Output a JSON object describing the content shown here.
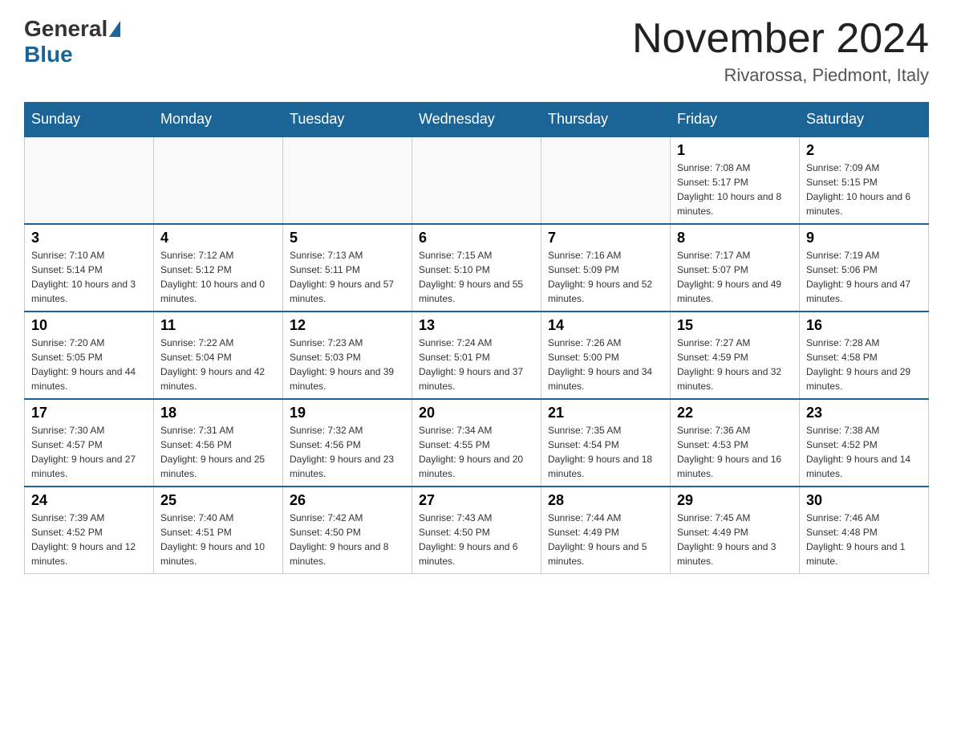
{
  "header": {
    "logo_general": "General",
    "logo_blue": "Blue",
    "month_year": "November 2024",
    "location": "Rivarossa, Piedmont, Italy"
  },
  "days_of_week": [
    "Sunday",
    "Monday",
    "Tuesday",
    "Wednesday",
    "Thursday",
    "Friday",
    "Saturday"
  ],
  "weeks": [
    [
      {
        "day": "",
        "info": ""
      },
      {
        "day": "",
        "info": ""
      },
      {
        "day": "",
        "info": ""
      },
      {
        "day": "",
        "info": ""
      },
      {
        "day": "",
        "info": ""
      },
      {
        "day": "1",
        "info": "Sunrise: 7:08 AM\nSunset: 5:17 PM\nDaylight: 10 hours and 8 minutes."
      },
      {
        "day": "2",
        "info": "Sunrise: 7:09 AM\nSunset: 5:15 PM\nDaylight: 10 hours and 6 minutes."
      }
    ],
    [
      {
        "day": "3",
        "info": "Sunrise: 7:10 AM\nSunset: 5:14 PM\nDaylight: 10 hours and 3 minutes."
      },
      {
        "day": "4",
        "info": "Sunrise: 7:12 AM\nSunset: 5:12 PM\nDaylight: 10 hours and 0 minutes."
      },
      {
        "day": "5",
        "info": "Sunrise: 7:13 AM\nSunset: 5:11 PM\nDaylight: 9 hours and 57 minutes."
      },
      {
        "day": "6",
        "info": "Sunrise: 7:15 AM\nSunset: 5:10 PM\nDaylight: 9 hours and 55 minutes."
      },
      {
        "day": "7",
        "info": "Sunrise: 7:16 AM\nSunset: 5:09 PM\nDaylight: 9 hours and 52 minutes."
      },
      {
        "day": "8",
        "info": "Sunrise: 7:17 AM\nSunset: 5:07 PM\nDaylight: 9 hours and 49 minutes."
      },
      {
        "day": "9",
        "info": "Sunrise: 7:19 AM\nSunset: 5:06 PM\nDaylight: 9 hours and 47 minutes."
      }
    ],
    [
      {
        "day": "10",
        "info": "Sunrise: 7:20 AM\nSunset: 5:05 PM\nDaylight: 9 hours and 44 minutes."
      },
      {
        "day": "11",
        "info": "Sunrise: 7:22 AM\nSunset: 5:04 PM\nDaylight: 9 hours and 42 minutes."
      },
      {
        "day": "12",
        "info": "Sunrise: 7:23 AM\nSunset: 5:03 PM\nDaylight: 9 hours and 39 minutes."
      },
      {
        "day": "13",
        "info": "Sunrise: 7:24 AM\nSunset: 5:01 PM\nDaylight: 9 hours and 37 minutes."
      },
      {
        "day": "14",
        "info": "Sunrise: 7:26 AM\nSunset: 5:00 PM\nDaylight: 9 hours and 34 minutes."
      },
      {
        "day": "15",
        "info": "Sunrise: 7:27 AM\nSunset: 4:59 PM\nDaylight: 9 hours and 32 minutes."
      },
      {
        "day": "16",
        "info": "Sunrise: 7:28 AM\nSunset: 4:58 PM\nDaylight: 9 hours and 29 minutes."
      }
    ],
    [
      {
        "day": "17",
        "info": "Sunrise: 7:30 AM\nSunset: 4:57 PM\nDaylight: 9 hours and 27 minutes."
      },
      {
        "day": "18",
        "info": "Sunrise: 7:31 AM\nSunset: 4:56 PM\nDaylight: 9 hours and 25 minutes."
      },
      {
        "day": "19",
        "info": "Sunrise: 7:32 AM\nSunset: 4:56 PM\nDaylight: 9 hours and 23 minutes."
      },
      {
        "day": "20",
        "info": "Sunrise: 7:34 AM\nSunset: 4:55 PM\nDaylight: 9 hours and 20 minutes."
      },
      {
        "day": "21",
        "info": "Sunrise: 7:35 AM\nSunset: 4:54 PM\nDaylight: 9 hours and 18 minutes."
      },
      {
        "day": "22",
        "info": "Sunrise: 7:36 AM\nSunset: 4:53 PM\nDaylight: 9 hours and 16 minutes."
      },
      {
        "day": "23",
        "info": "Sunrise: 7:38 AM\nSunset: 4:52 PM\nDaylight: 9 hours and 14 minutes."
      }
    ],
    [
      {
        "day": "24",
        "info": "Sunrise: 7:39 AM\nSunset: 4:52 PM\nDaylight: 9 hours and 12 minutes."
      },
      {
        "day": "25",
        "info": "Sunrise: 7:40 AM\nSunset: 4:51 PM\nDaylight: 9 hours and 10 minutes."
      },
      {
        "day": "26",
        "info": "Sunrise: 7:42 AM\nSunset: 4:50 PM\nDaylight: 9 hours and 8 minutes."
      },
      {
        "day": "27",
        "info": "Sunrise: 7:43 AM\nSunset: 4:50 PM\nDaylight: 9 hours and 6 minutes."
      },
      {
        "day": "28",
        "info": "Sunrise: 7:44 AM\nSunset: 4:49 PM\nDaylight: 9 hours and 5 minutes."
      },
      {
        "day": "29",
        "info": "Sunrise: 7:45 AM\nSunset: 4:49 PM\nDaylight: 9 hours and 3 minutes."
      },
      {
        "day": "30",
        "info": "Sunrise: 7:46 AM\nSunset: 4:48 PM\nDaylight: 9 hours and 1 minute."
      }
    ]
  ]
}
